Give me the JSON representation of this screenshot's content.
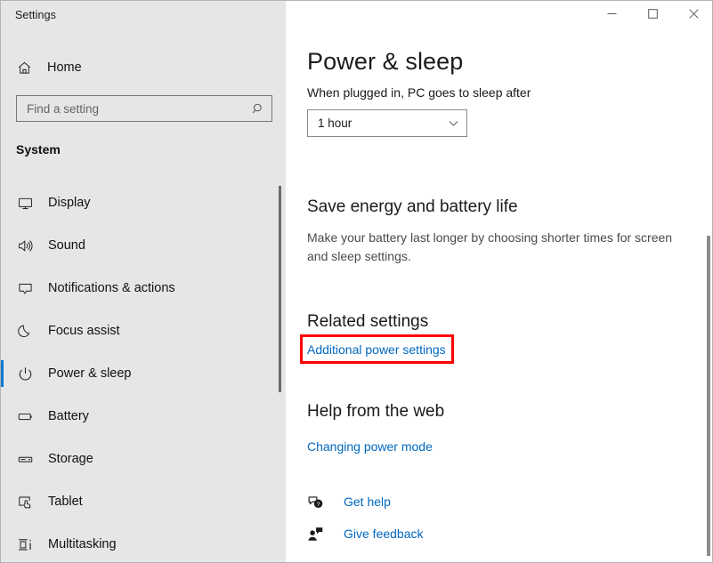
{
  "window": {
    "title": "Settings",
    "controls": [
      {
        "name": "minimize",
        "glyph": "minimize-icon"
      },
      {
        "name": "maximize",
        "glyph": "maximize-icon"
      },
      {
        "name": "close",
        "glyph": "close-icon"
      }
    ]
  },
  "sidebar": {
    "home": {
      "label": "Home",
      "icon": "home-icon"
    },
    "search": {
      "value": "",
      "placeholder": "Find a setting",
      "icon": "search-icon"
    },
    "group_title": "System",
    "items": [
      {
        "label": "Display",
        "icon": "display-icon",
        "selected": false
      },
      {
        "label": "Sound",
        "icon": "sound-icon",
        "selected": false
      },
      {
        "label": "Notifications & actions",
        "icon": "notifications-icon",
        "selected": false
      },
      {
        "label": "Focus assist",
        "icon": "moon-icon",
        "selected": false
      },
      {
        "label": "Power & sleep",
        "icon": "power-icon",
        "selected": true
      },
      {
        "label": "Battery",
        "icon": "battery-icon",
        "selected": false
      },
      {
        "label": "Storage",
        "icon": "storage-icon",
        "selected": false
      },
      {
        "label": "Tablet",
        "icon": "tablet-icon",
        "selected": false
      },
      {
        "label": "Multitasking",
        "icon": "multitasking-icon",
        "selected": false
      }
    ]
  },
  "main": {
    "page_title": "Power & sleep",
    "sleep": {
      "label": "When plugged in, PC goes to sleep after",
      "selected_value": "1 hour"
    },
    "save_energy": {
      "heading": "Save energy and battery life",
      "body": "Make your battery last longer by choosing shorter times for screen and sleep settings."
    },
    "related_settings": {
      "heading": "Related settings",
      "link": "Additional power settings"
    },
    "help_from_web": {
      "heading": "Help from the web",
      "link": "Changing power mode"
    },
    "footer": {
      "get_help": {
        "label": "Get help",
        "icon": "help-bubble-icon"
      },
      "give_feedback": {
        "label": "Give feedback",
        "icon": "feedback-person-icon"
      }
    }
  },
  "colors": {
    "accent": "#0078d4",
    "link": "#0067c0",
    "highlight_box": "#fe0000",
    "sidebar_bg": "#e6e6e6"
  }
}
